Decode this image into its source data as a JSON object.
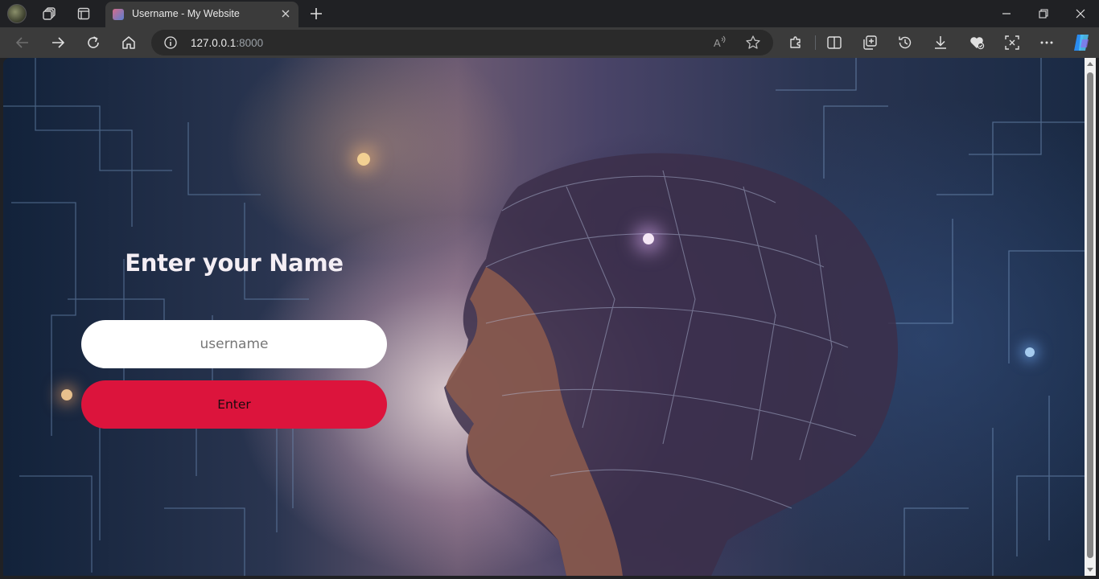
{
  "browser": {
    "tab": {
      "title": "Username - My Website"
    },
    "address": {
      "host": "127.0.0.1",
      "port": ":8000"
    },
    "icons": {
      "profile": "profile-avatar",
      "workspaces": "workspaces-icon",
      "tab_actions": "vertical-tabs-icon",
      "close_tab": "close-icon",
      "new_tab": "plus-icon",
      "back": "arrow-left-icon",
      "forward": "arrow-right-icon",
      "refresh": "refresh-icon",
      "home": "home-icon",
      "site_info": "info-icon",
      "read_aloud": "read-aloud-icon",
      "favorite": "star-icon",
      "extensions": "puzzle-icon",
      "split_screen": "split-screen-icon",
      "collections": "collections-icon",
      "history": "history-icon",
      "downloads": "download-icon",
      "performance": "heart-pulse-icon",
      "screenshot": "screenshot-icon",
      "more": "ellipsis-icon",
      "copilot": "copilot-icon"
    }
  },
  "page": {
    "heading": "Enter your Name",
    "username_placeholder": "username",
    "username_value": "",
    "submit_label": "Enter",
    "colors": {
      "submit_bg": "#dc143c",
      "heading": "#f4eef4"
    }
  }
}
